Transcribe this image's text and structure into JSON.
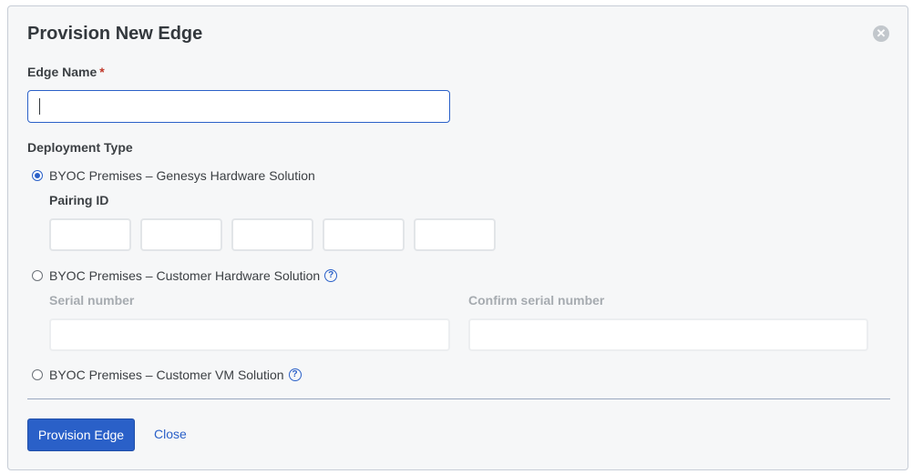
{
  "dialog": {
    "title": "Provision New Edge",
    "close_icon": "close-circle-icon"
  },
  "edge_name": {
    "label": "Edge Name",
    "required_mark": "*",
    "value": ""
  },
  "deployment": {
    "label": "Deployment Type",
    "options": [
      {
        "label": "BYOC Premises – Genesys Hardware Solution",
        "selected": true
      },
      {
        "label": "BYOC Premises – Customer Hardware Solution",
        "selected": false,
        "help_icon": "question-circle-icon"
      },
      {
        "label": "BYOC Premises – Customer VM Solution",
        "selected": false,
        "help_icon": "question-circle-icon"
      }
    ]
  },
  "pairing": {
    "label": "Pairing ID",
    "segments": [
      "",
      "",
      "",
      "",
      ""
    ]
  },
  "serial": {
    "label": "Serial number",
    "confirm_label": "Confirm serial number",
    "value": "",
    "confirm_value": ""
  },
  "footer": {
    "primary_label": "Provision Edge",
    "secondary_label": "Close"
  },
  "colors": {
    "accent": "#2a60c8",
    "required": "#c0392b",
    "background": "#f6f7f8"
  }
}
